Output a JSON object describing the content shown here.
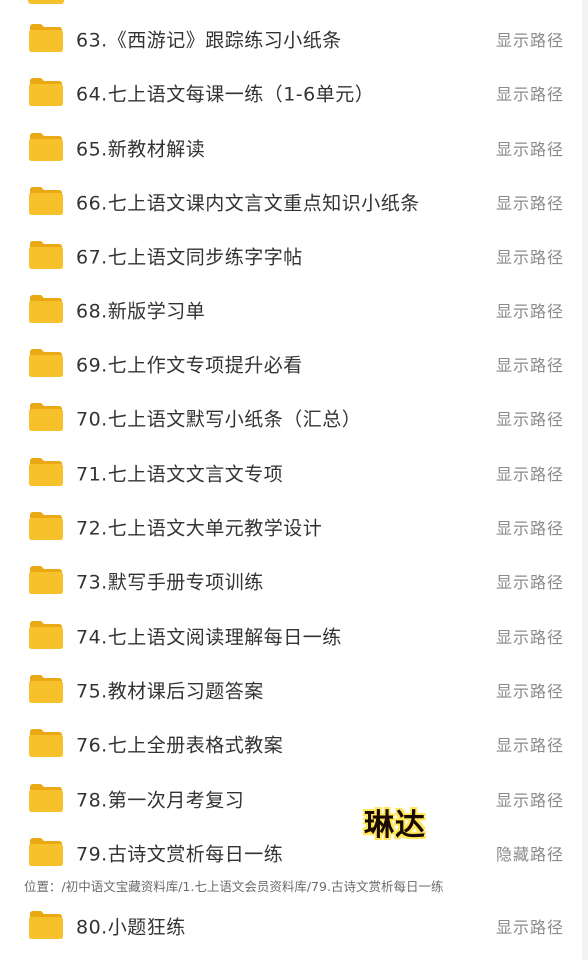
{
  "items": [
    {
      "name": "63.《西游记》跟踪练习小纸条",
      "action": "显示路径"
    },
    {
      "name": "64.七上语文每课一练（1-6单元）",
      "action": "显示路径"
    },
    {
      "name": "65.新教材解读",
      "action": "显示路径"
    },
    {
      "name": "66.七上语文课内文言文重点知识小纸条",
      "action": "显示路径"
    },
    {
      "name": "67.七上语文同步练字字帖",
      "action": "显示路径"
    },
    {
      "name": "68.新版学习单",
      "action": "显示路径"
    },
    {
      "name": "69.七上作文专项提升必看",
      "action": "显示路径"
    },
    {
      "name": "70.七上语文默写小纸条（汇总）",
      "action": "显示路径"
    },
    {
      "name": "71.七上语文文言文专项",
      "action": "显示路径"
    },
    {
      "name": "72.七上语文大单元教学设计",
      "action": "显示路径"
    },
    {
      "name": "73.默写手册专项训练",
      "action": "显示路径"
    },
    {
      "name": "74.七上语文阅读理解每日一练",
      "action": "显示路径"
    },
    {
      "name": "75.教材课后习题答案",
      "action": "显示路径"
    },
    {
      "name": "76.七上全册表格式教案",
      "action": "显示路径"
    },
    {
      "name": "78.第一次月考复习",
      "action": "显示路径"
    },
    {
      "name": "79.古诗文赏析每日一练",
      "action": "隐藏路径"
    },
    {
      "name": "80.小题狂练",
      "action": "显示路径"
    }
  ],
  "path_text": "位置：/初中语文宝藏资料库/1.七上语文会员资料库/79.古诗文赏析每日一练",
  "watermark": "琳达",
  "icon": "folder-icon",
  "colors": {
    "folder": "#f7c12c",
    "folder_dark": "#eaa914",
    "text": "#333333",
    "action": "#8a8a8a"
  }
}
